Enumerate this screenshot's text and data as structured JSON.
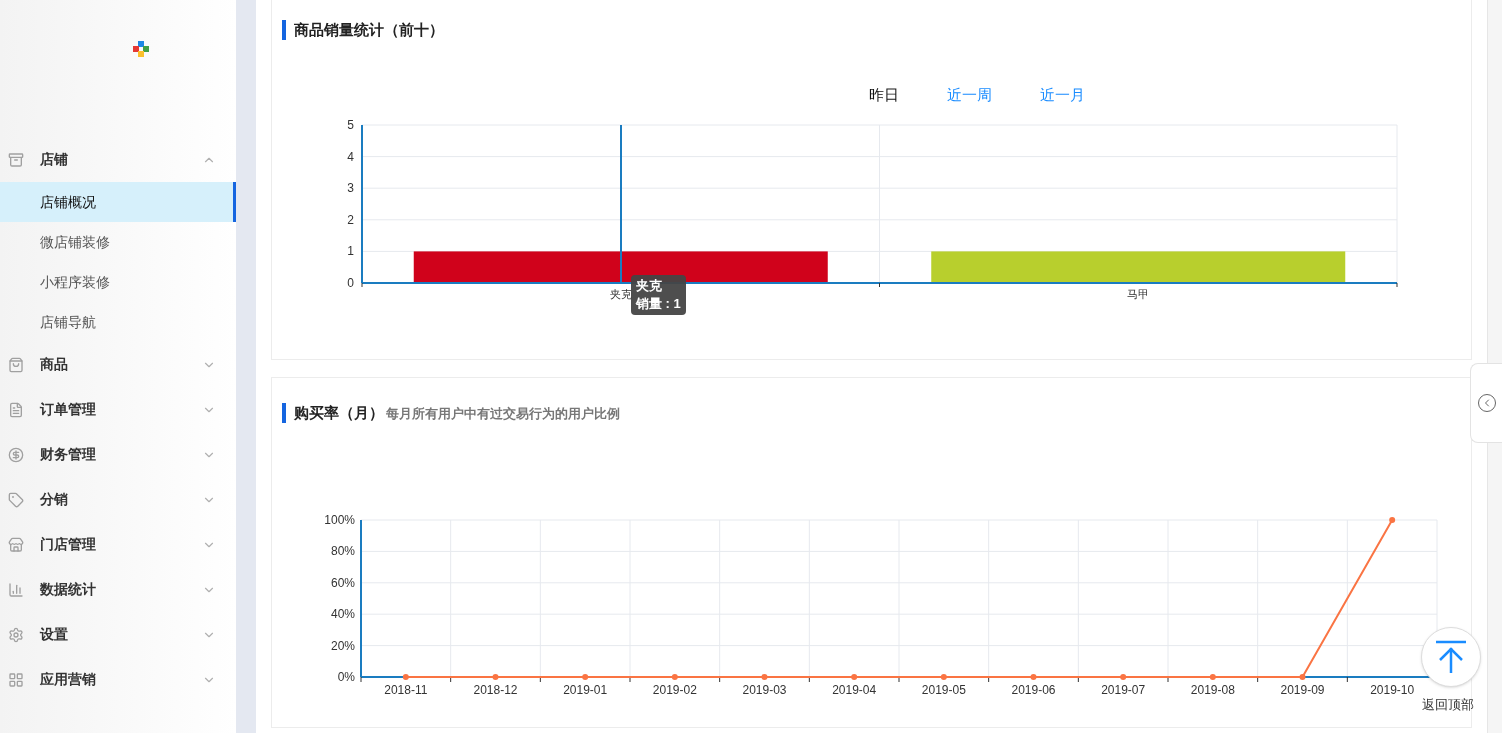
{
  "sidebar": {
    "items": [
      {
        "label": "店铺",
        "expanded": true,
        "children": [
          {
            "label": "店铺概况",
            "selected": true
          },
          {
            "label": "微店铺装修",
            "selected": false
          },
          {
            "label": "小程序装修",
            "selected": false
          },
          {
            "label": "店铺导航",
            "selected": false
          }
        ]
      },
      {
        "label": "商品",
        "expanded": false
      },
      {
        "label": "订单管理",
        "expanded": false
      },
      {
        "label": "财务管理",
        "expanded": false
      },
      {
        "label": "分销",
        "expanded": false
      },
      {
        "label": "门店管理",
        "expanded": false
      },
      {
        "label": "数据统计",
        "expanded": false
      },
      {
        "label": "设置",
        "expanded": false
      },
      {
        "label": "应用营销",
        "expanded": false
      }
    ]
  },
  "sales_card": {
    "title": "商品销量统计（前十）",
    "tabs": [
      {
        "label": "昨日",
        "selected": true
      },
      {
        "label": "近一周",
        "selected": false
      },
      {
        "label": "近一月",
        "selected": false
      }
    ],
    "chart_data": {
      "type": "bar",
      "categories": [
        "夹克",
        "马甲"
      ],
      "series": [
        {
          "color": "#d0021b",
          "values": [
            1,
            null
          ]
        },
        {
          "color": "#b8cf2d",
          "values": [
            null,
            1
          ]
        }
      ],
      "grid": true,
      "ylim": [
        0,
        5
      ],
      "yticks": [
        0,
        1,
        2,
        3,
        4,
        5
      ]
    },
    "tooltip": {
      "title": "夹克",
      "text": "销量 : 1"
    }
  },
  "rate_card": {
    "title": "购买率（月）",
    "subtitle": "每月所有用户中有过交易行为的用户比例",
    "chart_data": {
      "type": "line",
      "categories": [
        "2018-11",
        "2018-12",
        "2019-01",
        "2019-02",
        "2019-03",
        "2019-04",
        "2019-05",
        "2019-06",
        "2019-07",
        "2019-08",
        "2019-09",
        "2019-10"
      ],
      "series": [
        {
          "color": "#fa7443",
          "marker": "circle",
          "values": [
            0,
            0,
            0,
            0,
            0,
            0,
            0,
            0,
            0,
            0,
            0,
            100
          ]
        }
      ],
      "grid": true,
      "ylim": [
        0,
        100
      ],
      "yticks": [
        {
          "value": 0,
          "label": "0%"
        },
        {
          "value": 20,
          "label": "20%"
        },
        {
          "value": 40,
          "label": "40%"
        },
        {
          "value": 60,
          "label": "60%"
        },
        {
          "value": 80,
          "label": "80%"
        },
        {
          "value": 100,
          "label": "100%"
        }
      ]
    }
  },
  "back_to_top": {
    "label": "返回顶部"
  }
}
